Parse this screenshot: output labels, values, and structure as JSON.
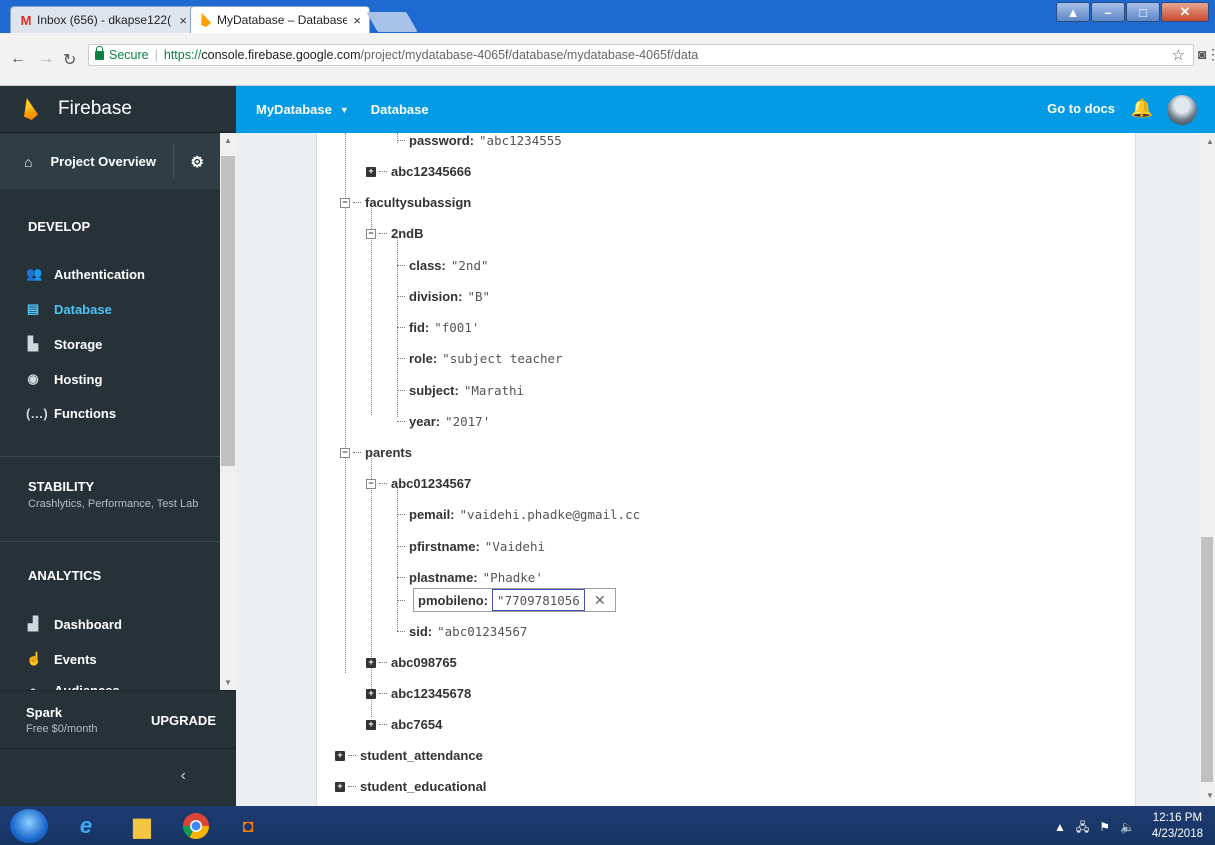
{
  "browser": {
    "tabs": [
      {
        "label": "Inbox (656) - dkapse122(",
        "icon": "gmail-icon",
        "close": "×"
      },
      {
        "label": "MyDatabase – Database - ",
        "icon": "firebase-icon",
        "close": "×"
      }
    ],
    "url": {
      "secure": "Secure",
      "scheme": "https://",
      "host": "console.firebase.google.com",
      "path": "/project/mydatabase-4065f/database/mydatabase-4065f/data"
    }
  },
  "header": {
    "project": "MyDatabase",
    "section": "Database",
    "docs": "Go to docs"
  },
  "sidebar": {
    "brand": "Firebase",
    "overview": "Project Overview",
    "develop": {
      "title": "DEVELOP",
      "items": [
        {
          "label": "Authentication",
          "icon": "people-icon"
        },
        {
          "label": "Database",
          "icon": "database-icon",
          "active": true
        },
        {
          "label": "Storage",
          "icon": "image-icon"
        },
        {
          "label": "Hosting",
          "icon": "globe-icon"
        },
        {
          "label": "Functions",
          "icon": "functions-icon"
        }
      ]
    },
    "stability": {
      "title": "STABILITY",
      "subtitle": "Crashlytics, Performance, Test Lab"
    },
    "analytics": {
      "title": "ANALYTICS",
      "items": [
        {
          "label": "Dashboard",
          "icon": "bar-chart-icon"
        },
        {
          "label": "Events",
          "icon": "touch-icon"
        },
        {
          "label": "Audiences",
          "icon": "audience-icon"
        }
      ]
    },
    "plan": {
      "name": "Spark",
      "price": "Free $0/month",
      "upgrade": "UPGRADE"
    }
  },
  "tree": {
    "n_password": {
      "key": "password:",
      "value": "\"abc1234555"
    },
    "n_abc12345666": {
      "key": "abc12345666"
    },
    "n_facultysubassign": {
      "key": "facultysubassign"
    },
    "n_2ndB": {
      "key": "2ndB"
    },
    "n_class": {
      "key": "class:",
      "value": "\"2nd\""
    },
    "n_division": {
      "key": "division:",
      "value": "\"B\""
    },
    "n_fid": {
      "key": "fid:",
      "value": "\"f001'"
    },
    "n_role": {
      "key": "role:",
      "value": "\"subject teacher"
    },
    "n_subject": {
      "key": "subject:",
      "value": "\"Marathi"
    },
    "n_year": {
      "key": "year:",
      "value": "\"2017'"
    },
    "n_parents": {
      "key": "parents"
    },
    "n_abc01234567": {
      "key": "abc01234567"
    },
    "n_pemail": {
      "key": "pemail:",
      "value": "\"vaidehi.phadke@gmail.cc"
    },
    "n_pfirstname": {
      "key": "pfirstname:",
      "value": "\"Vaidehi"
    },
    "n_plastname": {
      "key": "plastname:",
      "value": "\"Phadke'"
    },
    "n_pmobileno": {
      "key": "pmobileno:",
      "value": "\"7709781056"
    },
    "n_sid": {
      "key": "sid:",
      "value": "\"abc01234567"
    },
    "n_abc098765": {
      "key": "abc098765"
    },
    "n_abc12345678": {
      "key": "abc12345678"
    },
    "n_abc7654": {
      "key": "abc7654"
    },
    "n_student_attendance": {
      "key": "student_attendance"
    },
    "n_student_educational": {
      "key": "student_educational"
    }
  },
  "taskbar": {
    "time": "12:16 PM",
    "date": "4/23/2018"
  }
}
